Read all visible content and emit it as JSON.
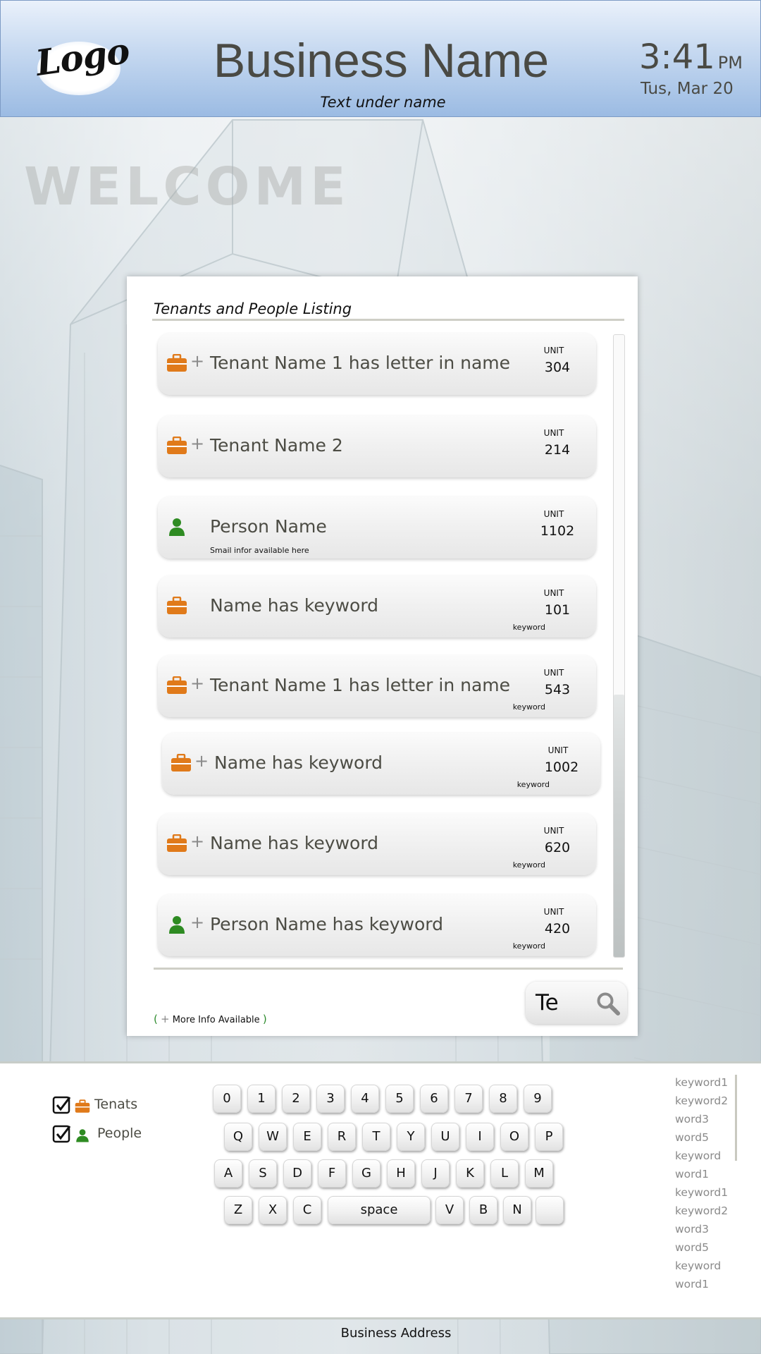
{
  "header": {
    "logo_text": "Logo",
    "business_name": "Business Name",
    "subtitle": "Text under name",
    "time": "3:41",
    "ampm": "PM",
    "date": "Tus, Mar 20"
  },
  "welcome": "WELCOME",
  "listing": {
    "title": "Tenants and People Listing",
    "unit_label": "UNIT",
    "rows": [
      {
        "type": "tenant",
        "has_more_info": true,
        "name": "Tenant Name 1 has letter in name",
        "unit": "304",
        "sub": "",
        "keyword": ""
      },
      {
        "type": "tenant",
        "has_more_info": true,
        "name": "Tenant Name 2",
        "unit": "214",
        "sub": "",
        "keyword": ""
      },
      {
        "type": "person",
        "has_more_info": false,
        "name": "Person Name",
        "unit": "1102",
        "sub": "Smail infor available here",
        "keyword": ""
      },
      {
        "type": "tenant",
        "has_more_info": false,
        "name": "Name has keyword",
        "unit": "101",
        "sub": "",
        "keyword": "keyword"
      },
      {
        "type": "tenant",
        "has_more_info": true,
        "name": "Tenant Name 1 has letter in name",
        "unit": "543",
        "sub": "",
        "keyword": "keyword"
      },
      {
        "type": "tenant",
        "has_more_info": true,
        "name": "Name has keyword",
        "unit": "1002",
        "sub": "",
        "keyword": "keyword"
      },
      {
        "type": "tenant",
        "has_more_info": true,
        "name": "Name has keyword",
        "unit": "620",
        "sub": "",
        "keyword": "keyword"
      },
      {
        "type": "person",
        "has_more_info": true,
        "name": "Person Name has keyword",
        "unit": "420",
        "sub": "",
        "keyword": "keyword"
      }
    ],
    "more_info": "More Info Available",
    "search_value": "Te"
  },
  "filters": {
    "tenants_label": "Tenats",
    "people_label": "People",
    "tenants_checked": true,
    "people_checked": true
  },
  "keyboard": {
    "row1": [
      "0",
      "1",
      "2",
      "3",
      "4",
      "5",
      "6",
      "7",
      "8",
      "9"
    ],
    "row2": [
      "Q",
      "W",
      "E",
      "R",
      "T",
      "Y",
      "U",
      "I",
      "O",
      "P"
    ],
    "row3": [
      "A",
      "S",
      "D",
      "F",
      "G",
      "H",
      "J",
      "K",
      "L",
      "M"
    ],
    "row4": [
      "Z",
      "X",
      "C",
      "space",
      "V",
      "B",
      "N",
      ""
    ]
  },
  "keyword_suggestions": [
    "keyword1",
    "keyword2",
    "word3",
    "word5",
    "keyword",
    "word1",
    "keyword1",
    "keyword2",
    "word3",
    "word5",
    "keyword",
    "word1"
  ],
  "footer": {
    "address": "Business Address"
  },
  "colors": {
    "tenant_icon": "#e07a1a",
    "person_icon": "#2e8b22",
    "header_blue": "#9bbbe3"
  }
}
